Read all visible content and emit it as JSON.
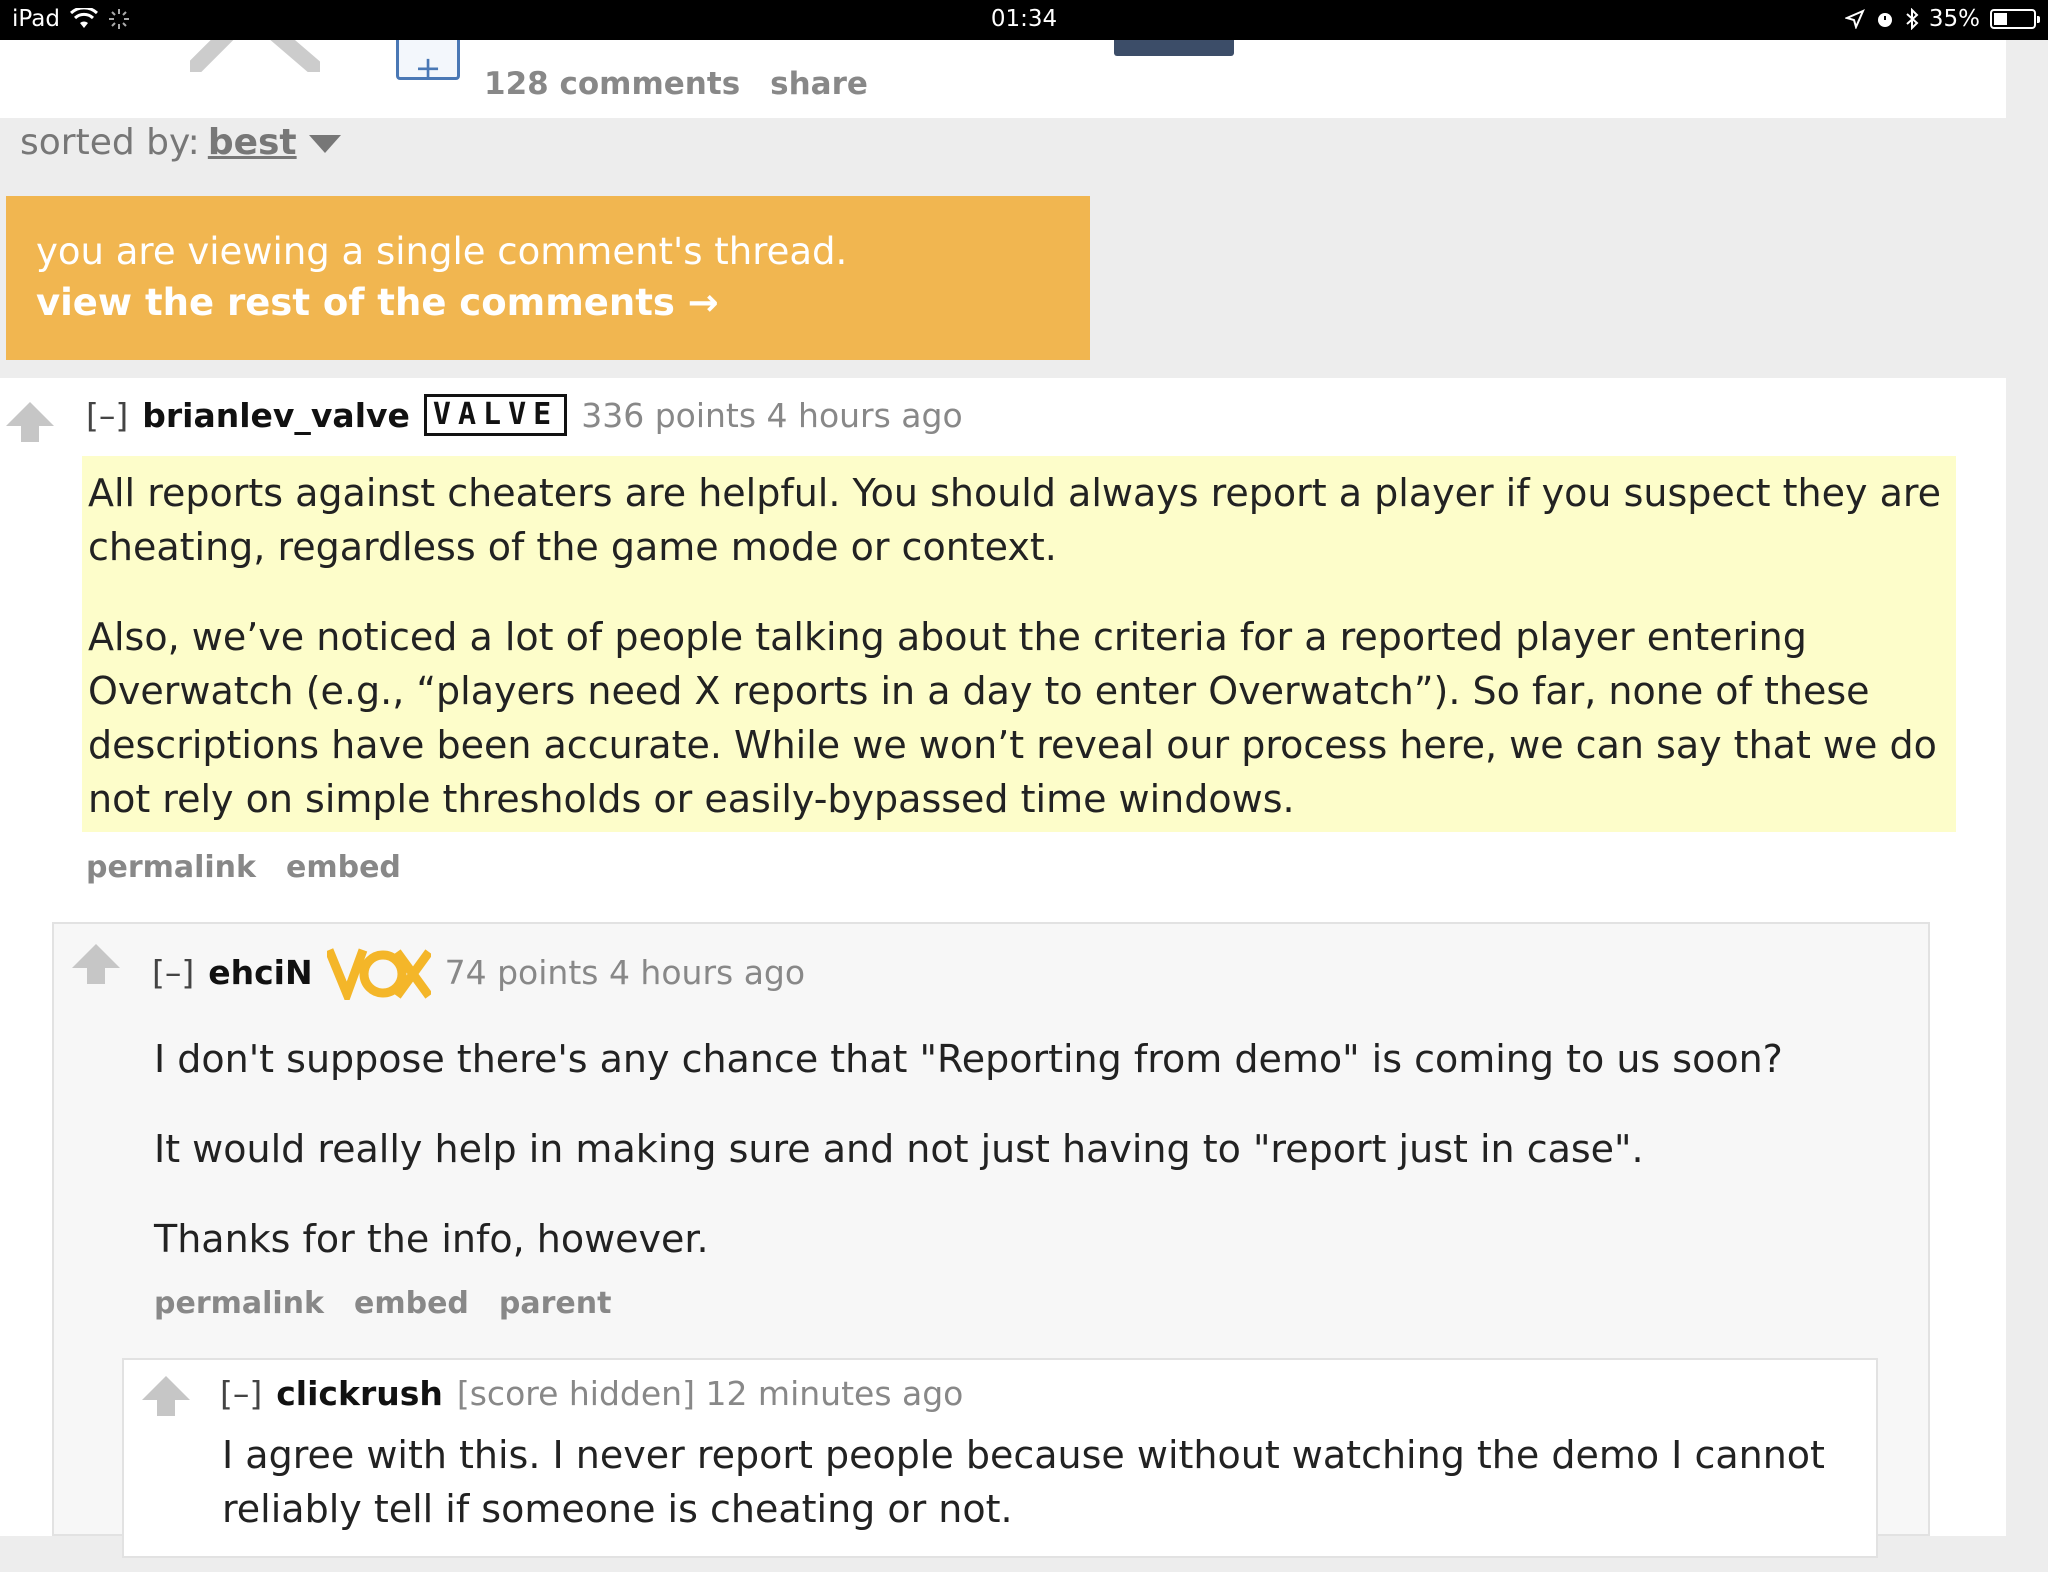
{
  "status_bar": {
    "device": "iPad",
    "time": "01:34",
    "battery": "35%",
    "battery_level": 0.35
  },
  "post": {
    "comments_link": "128 comments",
    "share_link": "share"
  },
  "sort": {
    "label": "sorted by:",
    "value": "best"
  },
  "banner": {
    "line1": "you are viewing a single comment's thread.",
    "line2": "view the rest of the comments →"
  },
  "comments": [
    {
      "collapse": "[–]",
      "author": "brianlev_valve",
      "flair": "VALVE",
      "meta": "336 points 4 hours ago",
      "paragraphs": [
        "All reports against cheaters are helpful. You should always report a player if you suspect they are cheating, regardless of the game mode or context.",
        "Also, we’ve noticed a lot of people talking about the criteria for a reported player entering Overwatch (e.g., “players need X reports in a day to enter Overwatch”). So far, none of these descriptions have been accurate. While we won’t reveal our process here, we can say that we do not rely on simple thresholds or easily-bypassed time windows."
      ],
      "actions": [
        "permalink",
        "embed"
      ]
    },
    {
      "collapse": "[–]",
      "author": "ehciN",
      "flair_icon": "vox-flair-icon",
      "meta": "74 points 4 hours ago",
      "paragraphs": [
        "I don't suppose there's any chance that \"Reporting from demo\" is coming to us soon?",
        "It would really help in making sure and not just having to \"report just in case\".",
        "Thanks for the info, however."
      ],
      "actions": [
        "permalink",
        "embed",
        "parent"
      ]
    },
    {
      "collapse": "[–]",
      "author": "clickrush",
      "meta": "[score hidden] 12 minutes ago",
      "paragraphs": [
        "I agree with this. I never report people because without watching the demo I cannot reliably tell if someone is cheating or not."
      ]
    }
  ],
  "colors": {
    "banner": "#f1b650",
    "highlight": "#fdfdca",
    "vote_arrow": "#c6c6c6"
  }
}
